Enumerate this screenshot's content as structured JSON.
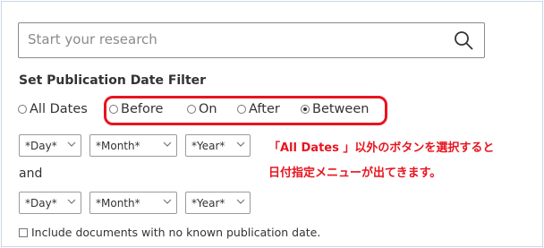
{
  "search": {
    "placeholder": "Start your research",
    "icon": "search-icon"
  },
  "filter": {
    "heading": "Set Publication Date Filter",
    "options": [
      {
        "label": "All Dates",
        "selected": false
      },
      {
        "label": "Before",
        "selected": false
      },
      {
        "label": "On",
        "selected": false
      },
      {
        "label": "After",
        "selected": false
      },
      {
        "label": "Between",
        "selected": true
      }
    ],
    "from": {
      "day": "*Day*",
      "month": "*Month*",
      "year": "*Year*"
    },
    "and_label": "and",
    "to": {
      "day": "*Day*",
      "month": "*Month*",
      "year": "*Year*"
    },
    "include_unknown_label": "Include documents with no known publication date.",
    "include_unknown_checked": false
  },
  "annotation": {
    "line1": "「All Dates 」以外のボタンを選択すると",
    "line2": "日付指定メニューが出てきます。",
    "color": "#e8141f"
  }
}
